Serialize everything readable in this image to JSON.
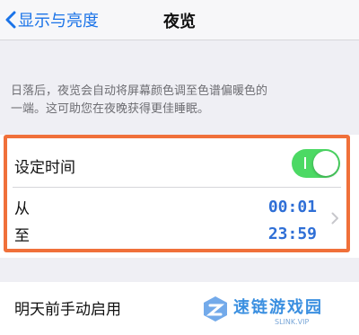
{
  "nav": {
    "back_label": "显示与亮度",
    "title": "夜览"
  },
  "description": {
    "line1": "日落后，夜览会自动将屏幕颜色调至色谱偏暖色的",
    "line2": "一端。这可助您在夜晚获得更佳睡眠。"
  },
  "schedule": {
    "label": "设定时间",
    "enabled": true,
    "from_label": "从",
    "from_time": "00:01",
    "to_label": "至",
    "to_time": "23:59"
  },
  "manual": {
    "label": "明天前手动启用"
  },
  "watermark": {
    "name": "速链游戏园",
    "url": "SLINK.VIP"
  },
  "colors": {
    "accent": "#2f6fd6",
    "toggle_on": "#4cd964",
    "highlight": "#f0703a"
  },
  "icons": [
    "chevron-left-icon",
    "chevron-right-icon",
    "watermark-logo-icon"
  ]
}
